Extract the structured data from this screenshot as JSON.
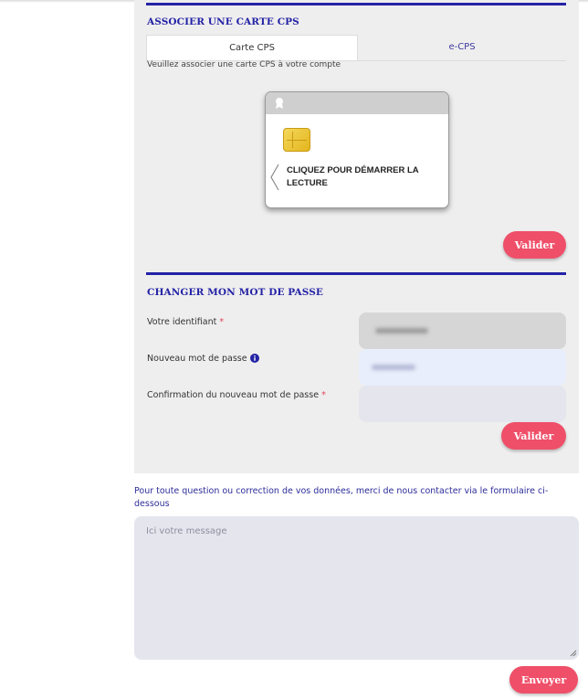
{
  "cps_section": {
    "title": "ASSOCIER UNE CARTE CPS",
    "tabs": [
      {
        "label": "Carte CPS",
        "active": true
      },
      {
        "label": "e-CPS",
        "active": false
      }
    ],
    "hint": "Veuillez associer une carte CPS à votre compte",
    "card": {
      "badge_icon": "ribbon-badge-icon",
      "chip_icon": "smartcard-chip-icon",
      "arrow_icon": "chevron-left-icon",
      "text": "CLIQUEZ POUR DÉMARRER LA LECTURE"
    },
    "submit_label": "Valider"
  },
  "password_section": {
    "title": "CHANGER MON MOT DE PASSE",
    "fields": {
      "identifier": {
        "label": "Votre identifiant",
        "required_mark": "*"
      },
      "new_password": {
        "label": "Nouveau mot de passe",
        "required_mark": "*",
        "info_icon": "info-circle-icon"
      },
      "confirm_password": {
        "label": "Confirmation du nouveau mot de passe",
        "required_mark": "*"
      }
    },
    "submit_label": "Valider"
  },
  "contact": {
    "text": "Pour toute question ou correction de vos données, merci de nous contacter via le formulaire ci-dessous",
    "message_placeholder": "Ici votre message",
    "submit_label": "Envoyer"
  },
  "colors": {
    "accent_blue": "#2323a6",
    "button_pink": "#ef4f69",
    "panel_grey": "#efeeee",
    "required_red": "#e0435c"
  }
}
